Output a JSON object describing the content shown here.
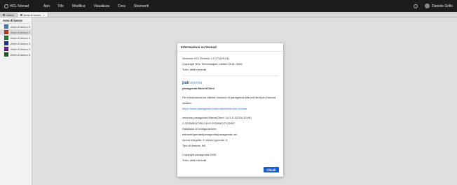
{
  "menubar": {
    "brand": "HCL Nomad",
    "items": [
      "Apri",
      "File",
      "Modifica",
      "Visualizza",
      "Crea",
      "Strumenti"
    ],
    "help_icon": "?",
    "user_name": "Daniele Grillo"
  },
  "tabs": [
    {
      "label": "Home"
    },
    {
      "label": "Area di lavoro",
      "close": "×"
    }
  ],
  "sidebar": {
    "header": "Area di lavoro",
    "items": [
      {
        "label": "Area di lavoro 0",
        "color": "#4a7fc1"
      },
      {
        "label": "Area di lavoro 1",
        "color": "#c0392b"
      },
      {
        "label": "Area di lavoro 2",
        "color": "#2e7d32"
      },
      {
        "label": "Area di lavoro 3",
        "color": "#283593"
      },
      {
        "label": "Area di lavoro 4",
        "color": "#6a1b9a"
      },
      {
        "label": "Area di lavoro 5",
        "color": "#1b5e20"
      }
    ],
    "selected_index": 1
  },
  "dialog": {
    "title": "Informazioni su Nomad",
    "version": "Versione HCL Nomad: 1.0.17(109-01)",
    "copyright": "Copyright HCL Technologies Limited 2013, 2025",
    "rights": "Tutti i diritti riservati",
    "logo_mark": "pan",
    "logo_name": "agenda",
    "product_name": "panagenda MarvelClient",
    "info_text": "Per informazioni su ulteriori funzioni di panagenda MarvelClient per Nomad, visitare:",
    "info_link": "https://www.panagenda.com/marvelclient-for-nomad",
    "mc_version": "versione panagenda MarvelClient: 14.5.5.11233 (32-bit)",
    "mc_build": "C:20250811T090749.E:20250811T112657",
    "mc_config_db": "Database di configurazione:",
    "mc_config_path": "extranet/gredaet/panagenda/panagenda.nsf",
    "mc_actions": "Azioni eseguite: 2, Azioni ignorate: 6",
    "mc_license": "Tipo di licenza: full",
    "pano_copyright": "Copyright panagenda 2025",
    "pano_rights": "Tutti i diritti riservati",
    "close_label": "Chiudi"
  },
  "colors": {
    "menubar_bg": "#1c1c1c",
    "accent": "#1c5cc4",
    "link": "#2a6fc9"
  }
}
